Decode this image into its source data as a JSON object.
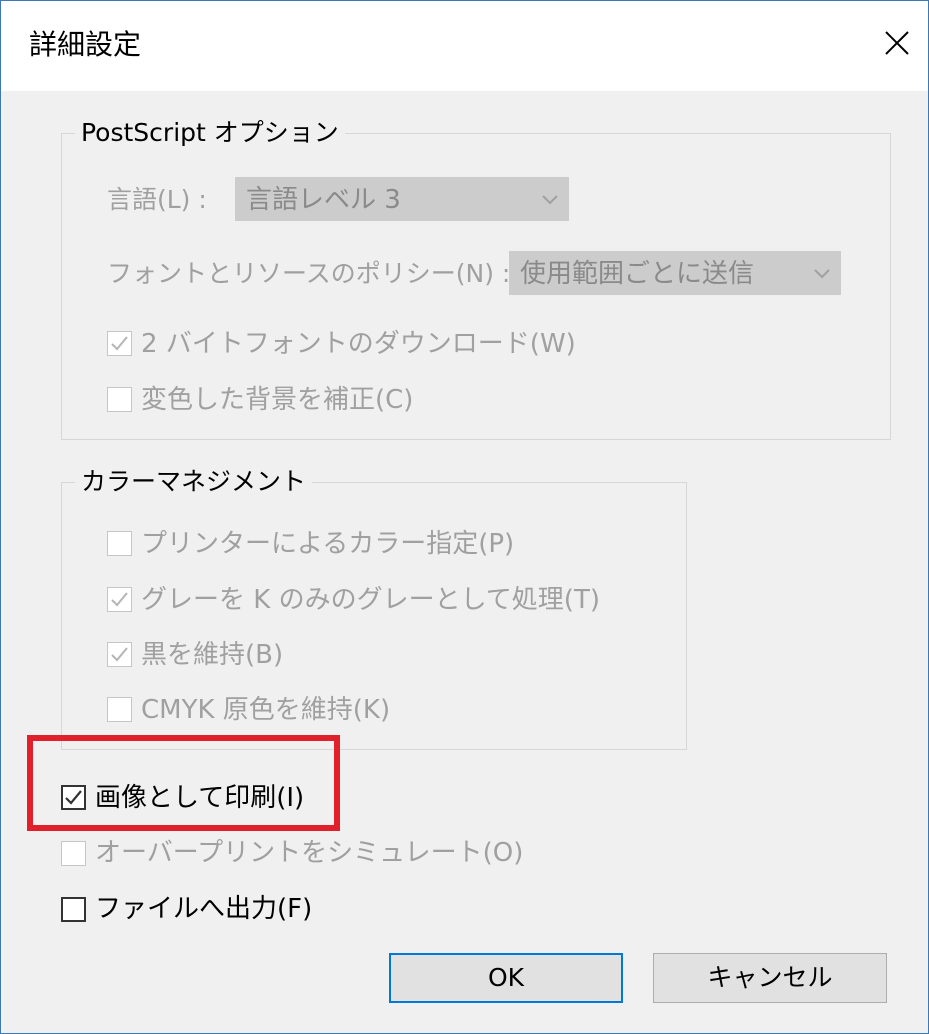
{
  "dialog": {
    "title": "詳細設定",
    "close_label": "×"
  },
  "postscript": {
    "legend": "PostScript オプション",
    "language_label": "言語(L) :",
    "language_value": "言語レベル 3",
    "font_policy_label": "フォントとリソースのポリシー(N) :",
    "font_policy_value": "使用範囲ごとに送信",
    "download_2byte_label": "2 バイトフォントのダウンロード(W)",
    "download_2byte_checked": true,
    "correct_faded_bg_label": "変色した背景を補正(C)",
    "correct_faded_bg_checked": false
  },
  "color_management": {
    "legend": "カラーマネジメント",
    "printer_color_label": "プリンターによるカラー指定(P)",
    "printer_color_checked": false,
    "gray_as_k_label": "グレーを K のみのグレーとして処理(T)",
    "gray_as_k_checked": true,
    "preserve_black_label": "黒を維持(B)",
    "preserve_black_checked": true,
    "preserve_cmyk_label": "CMYK 原色を維持(K)",
    "preserve_cmyk_checked": false
  },
  "options": {
    "print_as_image_label": "画像として印刷(I)",
    "print_as_image_checked": true,
    "simulate_overprint_label": "オーバープリントをシミュレート(O)",
    "simulate_overprint_checked": false,
    "print_to_file_label": "ファイルへ出力(F)",
    "print_to_file_checked": false
  },
  "buttons": {
    "ok_label": "OK",
    "cancel_label": "キャンセル"
  },
  "colors": {
    "highlight": "#e0202a",
    "default_button_border": "#0078d7",
    "disabled_text": "#a0a0a0"
  }
}
